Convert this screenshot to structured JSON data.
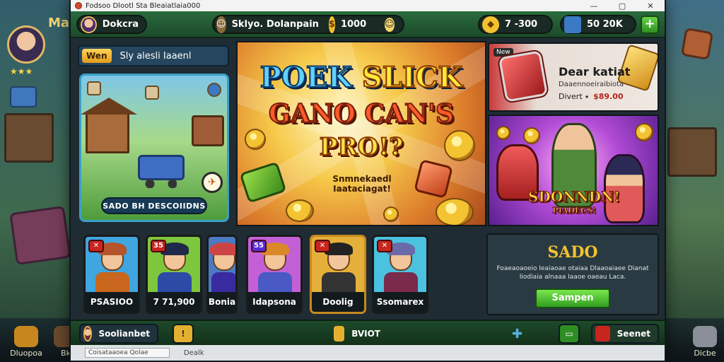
{
  "window": {
    "title": "Fodsoo Dlootl Sta Bleaiatlaia000",
    "controls": {
      "minimize": "—",
      "maximize": "▢",
      "close": "✕"
    }
  },
  "background": {
    "title": "Ma",
    "dock": [
      {
        "label": "Dluopoa",
        "icon": "drum-icon"
      },
      {
        "label": "Bk",
        "icon": "hut-icon"
      },
      {
        "label": "Dicbe",
        "icon": "sword-icon"
      }
    ]
  },
  "topbar": {
    "player_name": "Dokcra",
    "center_label": "Sklyo.",
    "center_value": "Dolanpain",
    "coins": "1000",
    "gems_value": "7 -300",
    "chest_value": "50 20K",
    "plus": "+"
  },
  "news": {
    "badge": "Wen",
    "text": "Sly  alesli  Iaaenl"
  },
  "feature_card": {
    "caption": "SADO BH DESCOIIDNS"
  },
  "banner": {
    "line1a": "POEK ",
    "line1b": "SLICK",
    "line2": "GANO CAN'S",
    "line3": "PRO!?",
    "sub": "Snmnekaedl Iaataciagat!"
  },
  "promo_top": {
    "tag": "New",
    "title": "Dear katiat",
    "desc": "Daaennoeiraibiota",
    "price_label": "Divert  ⭑",
    "price_value": "$89.00"
  },
  "promo_mid": {
    "title": "SDONNDN!",
    "subtitle": "PIADECS!"
  },
  "characters": [
    {
      "badge": "✕",
      "label": "PSASIOO",
      "bg": "#3fa6e0",
      "hair": "#b5532a",
      "body": "#c8661e"
    },
    {
      "badge": "35",
      "label": "7 71,900",
      "bg": "#7ec63d",
      "hair": "#1f2a4a",
      "body": "#2c4aa6"
    },
    {
      "badge": "",
      "label": "Bonia",
      "bg": "#4a7ac4",
      "hair": "#c44",
      "body": "#3a2aa0"
    },
    {
      "badge": "55",
      "label": "Idapsona",
      "bg": "#c460d6",
      "hair": "#d9882a",
      "body": "#4a5ac4"
    },
    {
      "badge": "✕",
      "label": "Doolig",
      "bg": "#e5b03a",
      "hair": "#222",
      "body": "#333"
    },
    {
      "badge": "✕",
      "label": "Ssomarex",
      "bg": "#4ac2e0",
      "hair": "#6a6aa8",
      "body": "#7a2a4a"
    }
  ],
  "sado": {
    "title": "SADO",
    "text": "Foaeaoaoeio Ieaiaoae otaiaa Dlaaoaiaee Dianat Iiodiaia alnaaa Iaaoe oaeau Laca.",
    "cta": "Sampen"
  },
  "bottombar": {
    "left": "Soolianbet",
    "center": "BVIOT",
    "right": "Seenet"
  },
  "statusline": {
    "field1": "Coisataaoea Qolae",
    "text": "Dealk"
  }
}
